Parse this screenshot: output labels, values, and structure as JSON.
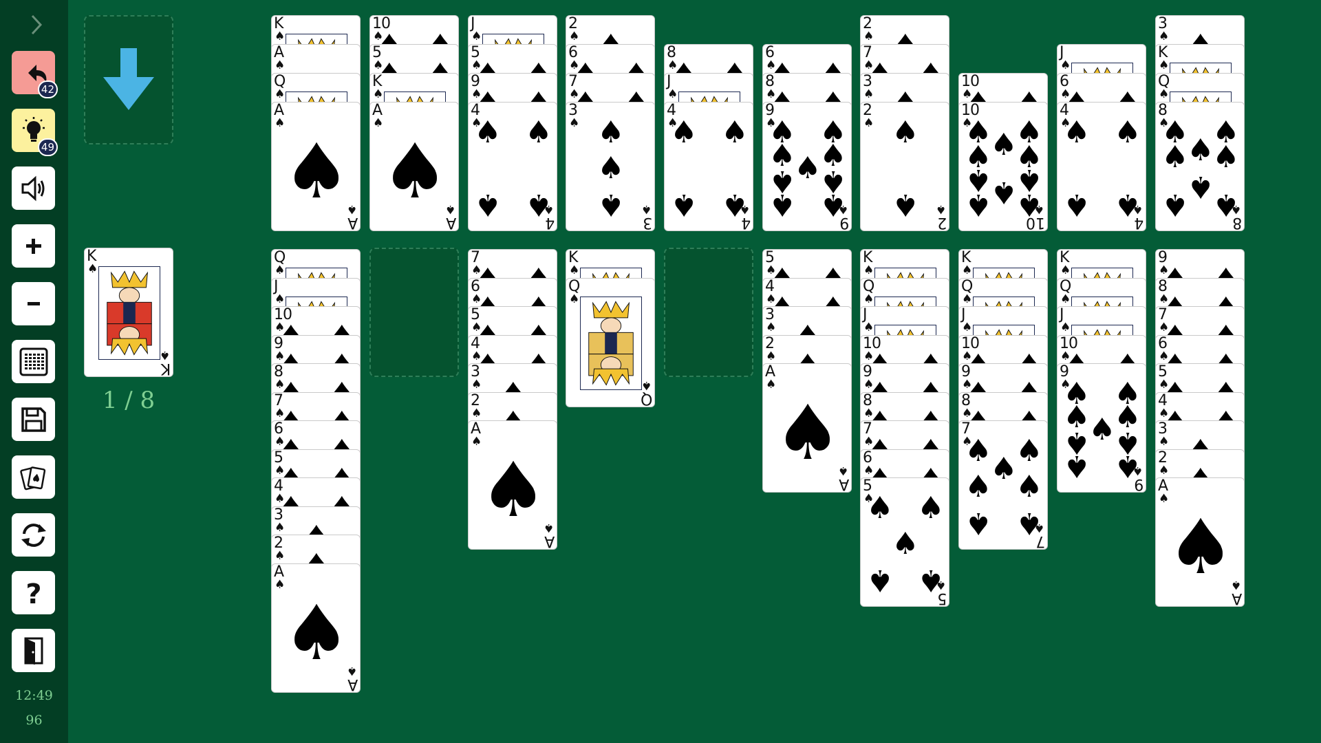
{
  "colors": {
    "background": "#045c37",
    "sidebar": "#033e24",
    "undo": "#f59b95",
    "hint": "#fcf19e",
    "arrow": "#4bb4e4",
    "text": "#7fcf92"
  },
  "sidebar": {
    "buttons": [
      {
        "id": "undo",
        "icon": "undo-icon",
        "badge": "42"
      },
      {
        "id": "hint",
        "icon": "lightbulb-icon",
        "badge": "49"
      },
      {
        "id": "sound",
        "icon": "speaker-icon"
      },
      {
        "id": "zoom-in",
        "icon": "plus-icon"
      },
      {
        "id": "zoom-out",
        "icon": "minus-icon"
      },
      {
        "id": "layout",
        "icon": "grid-icon"
      },
      {
        "id": "save",
        "icon": "save-icon"
      },
      {
        "id": "cards",
        "icon": "cards-icon"
      },
      {
        "id": "restart",
        "icon": "refresh-icon"
      },
      {
        "id": "help",
        "icon": "question-icon"
      },
      {
        "id": "exit",
        "icon": "exit-door-icon"
      }
    ],
    "time": "12:49",
    "score": "96"
  },
  "stock": {
    "icon": "down-arrow-icon"
  },
  "foundation": {
    "card": {
      "rank": "K",
      "suit": "♠"
    },
    "counter": "1 / 8"
  },
  "suit": "♠",
  "top_row": [
    [
      "K",
      "A",
      "Q",
      "A"
    ],
    [
      "10",
      "5",
      "K",
      "A"
    ],
    [
      "J",
      "5",
      "9",
      "4"
    ],
    [
      "2",
      "6",
      "7",
      "3"
    ],
    [
      "8",
      "J",
      "4"
    ],
    [
      "6",
      "8",
      "9"
    ],
    [
      "2",
      "7",
      "3",
      "2"
    ],
    [
      "10",
      "10"
    ],
    [
      "J",
      "6",
      "4"
    ],
    [
      "3",
      "K",
      "Q",
      "8"
    ]
  ],
  "tableau": [
    [
      "Q",
      "J",
      "10",
      "9",
      "8",
      "7",
      "6",
      "5",
      "4",
      "3",
      "2",
      "A"
    ],
    [],
    [
      "7",
      "6",
      "5",
      "4",
      "3",
      "2",
      "A"
    ],
    [
      "K",
      "Q"
    ],
    [],
    [
      "5",
      "4",
      "3",
      "2",
      "A"
    ],
    [
      "K",
      "Q",
      "J",
      "10",
      "9",
      "8",
      "7",
      "6",
      "5"
    ],
    [
      "K",
      "Q",
      "J",
      "10",
      "9",
      "8",
      "7"
    ],
    [
      "K",
      "Q",
      "J",
      "10",
      "9"
    ],
    [
      "9",
      "8",
      "7",
      "6",
      "5",
      "4",
      "3",
      "2",
      "A"
    ]
  ]
}
